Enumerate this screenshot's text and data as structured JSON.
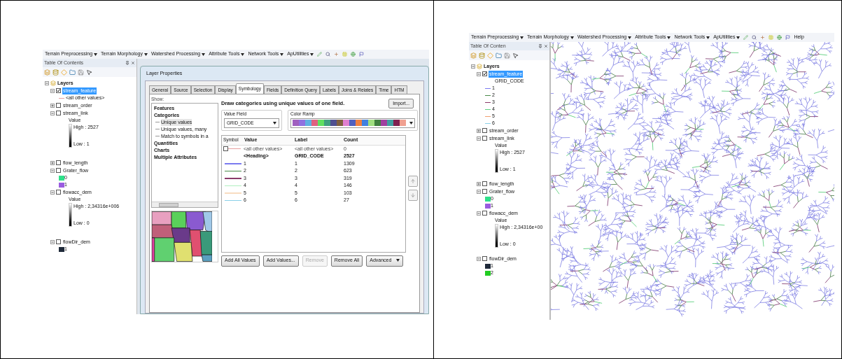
{
  "left_screenshot": {
    "toolbar": {
      "menus": [
        "Terrain Preprocessing",
        "Terrain Morphology",
        "Watershed Processing",
        "Attribute Tools",
        "Network Tools",
        "ApUtilities"
      ]
    },
    "toc": {
      "title": "Table Of Contents",
      "root": {
        "label": "Layers",
        "expanded": true,
        "children": [
          {
            "name": "stream_feature",
            "expanded": true,
            "checked": true,
            "selected": true,
            "legend": [
              {
                "kind": "line",
                "color": "#e8a0a0",
                "label": "<all other values>"
              }
            ]
          },
          {
            "name": "stream_order",
            "expanded": false,
            "checked": false,
            "selected": false
          },
          {
            "name": "stream_link",
            "expanded": true,
            "checked": false,
            "selected": false,
            "legend": [
              {
                "kind": "gradient",
                "title": "Value",
                "high": "High : 2527",
                "low": "Low : 1"
              }
            ]
          },
          {
            "name": "flow_length",
            "expanded": false,
            "checked": false,
            "selected": false
          },
          {
            "name": "Grater_flow",
            "expanded": true,
            "checked": false,
            "selected": false,
            "legend": [
              {
                "kind": "swatch",
                "color": "#2ee08a",
                "label": "0"
              },
              {
                "kind": "swatch",
                "color": "#9a5ce0",
                "label": "1"
              }
            ]
          },
          {
            "name": "flowacc_dem",
            "expanded": true,
            "checked": false,
            "selected": false,
            "legend": [
              {
                "kind": "gradient",
                "title": "Value",
                "high": "High : 2,34316e+006",
                "low": "Low : 0"
              }
            ]
          },
          {
            "name": "flowDir_dem",
            "expanded": true,
            "checked": false,
            "selected": false,
            "legend": [
              {
                "kind": "swatch",
                "color": "#1f2a3a",
                "label": "1"
              }
            ]
          }
        ]
      }
    },
    "layer_properties": {
      "title": "Layer Properties",
      "tabs": [
        {
          "label": "General",
          "selected": false
        },
        {
          "label": "Source",
          "selected": false
        },
        {
          "label": "Selection",
          "selected": false
        },
        {
          "label": "Display",
          "selected": false
        },
        {
          "label": "Symbology",
          "selected": true
        },
        {
          "label": "Fields",
          "selected": false
        },
        {
          "label": "Definition Query",
          "selected": false
        },
        {
          "label": "Labels",
          "selected": false
        },
        {
          "label": "Joins & Relates",
          "selected": false
        },
        {
          "label": "Time",
          "selected": false
        },
        {
          "label": "HTM",
          "selected": false
        }
      ],
      "show_label": "Show:",
      "show_tree": [
        {
          "label": "Features"
        },
        {
          "label": "Categories",
          "children": [
            {
              "label": "Unique values",
              "selected": true
            },
            {
              "label": "Unique values, many",
              "selected": false
            },
            {
              "label": "Match to symbols in a",
              "selected": false
            }
          ]
        },
        {
          "label": "Quantities"
        },
        {
          "label": "Charts"
        },
        {
          "label": "Multiple Attributes"
        }
      ],
      "description": "Draw categories using unique values of one field.",
      "import_button": "Import...",
      "value_field": {
        "label": "Value Field",
        "value": "GRID_CODE"
      },
      "color_ramp": {
        "label": "Color Ramp"
      },
      "table": {
        "columns": [
          "Symbol",
          "Value",
          "Label",
          "Count"
        ],
        "rows": [
          {
            "kind": "other",
            "color": "#e8a0a0",
            "value": "<all other values>",
            "label": "<all other values>",
            "count": "0"
          },
          {
            "kind": "heading",
            "value": "<Heading>",
            "label": "GRID_CODE",
            "count": "2527"
          },
          {
            "kind": "line",
            "color": "#7b7bf0",
            "value": "1",
            "label": "1",
            "count": "1309"
          },
          {
            "kind": "line",
            "color": "#4a8a4a",
            "value": "2",
            "label": "2",
            "count": "623"
          },
          {
            "kind": "line",
            "color": "#8a3a6a",
            "value": "3",
            "label": "3",
            "count": "319"
          },
          {
            "kind": "line",
            "color": "#b0f0c0",
            "value": "4",
            "label": "4",
            "count": "146"
          },
          {
            "kind": "line",
            "color": "#f8dcc0",
            "value": "5",
            "label": "5",
            "count": "103"
          },
          {
            "kind": "line",
            "color": "#8ad0e8",
            "value": "6",
            "label": "6",
            "count": "27"
          }
        ]
      },
      "buttons": [
        {
          "label": "Add All Values",
          "disabled": false,
          "dropdown": false
        },
        {
          "label": "Add Values...",
          "disabled": false,
          "dropdown": false
        },
        {
          "label": "Remove",
          "disabled": true,
          "dropdown": false
        },
        {
          "label": "Remove All",
          "disabled": false,
          "dropdown": false
        },
        {
          "label": "Advanced",
          "disabled": false,
          "dropdown": true
        }
      ]
    }
  },
  "right_screenshot": {
    "toolbar": {
      "menus": [
        "Terrain Preprocessing",
        "Terrain Morphology",
        "Watershed Processing",
        "Attribute Tools",
        "Network Tools",
        "ApUtilities"
      ],
      "help": "Help"
    },
    "toc": {
      "title": "Table Of Conten",
      "root": {
        "label": "Layers",
        "expanded": true,
        "children": [
          {
            "name": "stream_feature",
            "expanded": true,
            "checked": true,
            "selected": true,
            "legend": [
              {
                "kind": "heading",
                "label": "GRID_CODE"
              },
              {
                "kind": "line",
                "color": "#7b7bf0",
                "label": "1"
              },
              {
                "kind": "line",
                "color": "#4a8a4a",
                "label": "2"
              },
              {
                "kind": "line",
                "color": "#8a3a6a",
                "label": "3"
              },
              {
                "kind": "line",
                "color": "#60d080",
                "label": "4"
              },
              {
                "kind": "line",
                "color": "#f0a070",
                "label": "5"
              },
              {
                "kind": "line",
                "color": "#8ad0e8",
                "label": "6"
              }
            ]
          },
          {
            "name": "stream_order",
            "expanded": false,
            "checked": false,
            "selected": false
          },
          {
            "name": "stream_link",
            "expanded": true,
            "checked": false,
            "selected": false,
            "legend": [
              {
                "kind": "gradient",
                "title": "Value",
                "high": "High : 2527",
                "low": "Low : 1"
              }
            ]
          },
          {
            "name": "flow_length",
            "expanded": false,
            "checked": false,
            "selected": false
          },
          {
            "name": "Grater_flow",
            "expanded": true,
            "checked": false,
            "selected": false,
            "legend": [
              {
                "kind": "swatch",
                "color": "#2ee08a",
                "label": "0"
              },
              {
                "kind": "swatch",
                "color": "#9a5ce0",
                "label": "1"
              }
            ]
          },
          {
            "name": "flowacc_dem",
            "expanded": true,
            "checked": false,
            "selected": false,
            "legend": [
              {
                "kind": "gradient",
                "title": "Value",
                "high": "High : 2,34316e+00",
                "low": "Low : 0"
              }
            ]
          },
          {
            "name": "flowDir_dem",
            "expanded": true,
            "checked": false,
            "selected": false,
            "legend": [
              {
                "kind": "swatch",
                "color": "#1f2a3a",
                "label": "1"
              },
              {
                "kind": "swatch",
                "color": "#22cc22",
                "label": "2"
              }
            ]
          }
        ]
      }
    }
  }
}
